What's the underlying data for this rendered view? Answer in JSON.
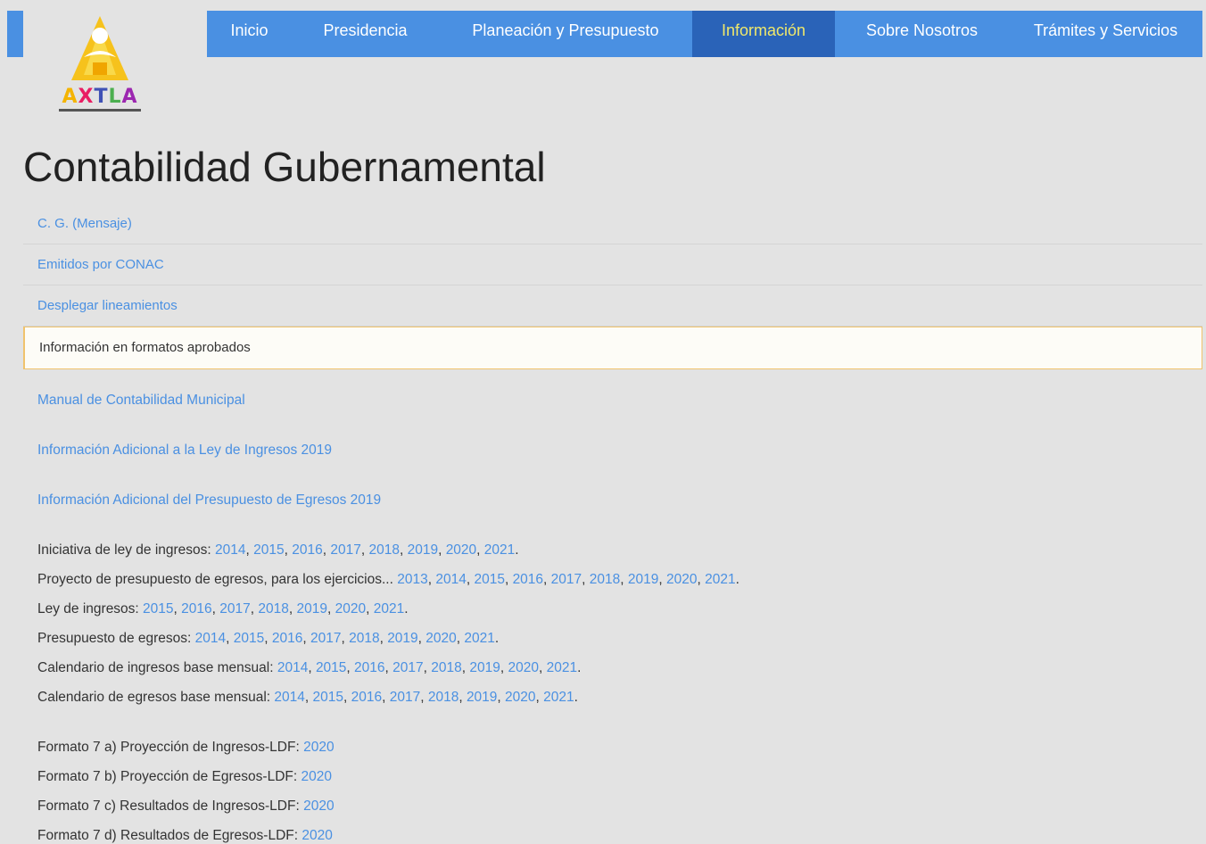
{
  "header": {
    "logo": {
      "text_letters": [
        "A",
        "X",
        "T",
        "L",
        "A"
      ],
      "brand_colors": [
        "#f4b400",
        "#e91e63",
        "#3f51b5",
        "#4caf50",
        "#9c27b0"
      ]
    },
    "nav": [
      {
        "label": "Inicio",
        "active": false
      },
      {
        "label": "Presidencia",
        "active": false
      },
      {
        "label": "Planeación y Presupuesto",
        "active": false
      },
      {
        "label": "Información",
        "active": true
      },
      {
        "label": "Sobre Nosotros",
        "active": false
      },
      {
        "label": "Trámites y Servicios",
        "active": false
      }
    ]
  },
  "page": {
    "title": "Contabilidad Gubernamental"
  },
  "menu": [
    {
      "label": "C. G. (Mensaje)",
      "selected": false
    },
    {
      "label": "Emitidos por CONAC",
      "selected": false
    },
    {
      "label": "Desplegar lineamientos",
      "selected": false
    },
    {
      "label": "Información en formatos aprobados",
      "selected": true
    }
  ],
  "links": [
    "Manual de Contabilidad Municipal",
    "Información Adicional a la Ley de Ingresos 2019",
    "Información Adicional del Presupuesto de Egresos 2019"
  ],
  "year_rows": [
    {
      "label": "Iniciativa de ley de ingresos: ",
      "years": [
        "2014",
        "2015",
        "2016",
        "2017",
        "2018",
        "2019",
        "2020",
        "2021"
      ]
    },
    {
      "label": "Proyecto de presupuesto de egresos, para los ejercicios... ",
      "years": [
        "2013",
        "2014",
        "2015",
        "2016",
        "2017",
        "2018",
        "2019",
        "2020",
        "2021"
      ]
    },
    {
      "label": "Ley de ingresos: ",
      "years": [
        "2015",
        "2016",
        "2017",
        "2018",
        "2019",
        "2020",
        "2021"
      ]
    },
    {
      "label": "Presupuesto de egresos: ",
      "years": [
        "2014",
        "2015",
        "2016",
        "2017",
        "2018",
        "2019",
        "2020",
        "2021"
      ]
    },
    {
      "label": "Calendario de ingresos base mensual: ",
      "years": [
        "2014",
        "2015",
        "2016",
        "2017",
        "2018",
        "2019",
        "2020",
        "2021"
      ]
    },
    {
      "label": "Calendario de egresos base mensual: ",
      "years": [
        "2014",
        "2015",
        "2016",
        "2017",
        "2018",
        "2019",
        "2020",
        "2021"
      ]
    }
  ],
  "formato_rows": [
    {
      "label": "Formato 7 a) Proyección de Ingresos-LDF: ",
      "year": "2020"
    },
    {
      "label": "Formato 7 b) Proyección de Egresos-LDF: ",
      "year": "2020"
    },
    {
      "label": "Formato 7 c) Resultados de Ingresos-LDF: ",
      "year": "2020"
    },
    {
      "label": "Formato 7 d) Resultados de Egresos-LDF: ",
      "year": "2020"
    }
  ]
}
